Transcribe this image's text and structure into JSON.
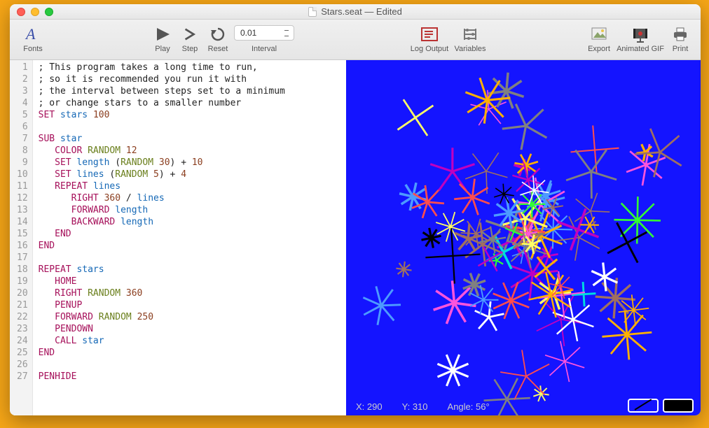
{
  "window": {
    "title": "Stars.seat — Edited"
  },
  "toolbar": {
    "fonts": "Fonts",
    "play": "Play",
    "step": "Step",
    "reset": "Reset",
    "interval_label": "Interval",
    "interval_value": "0.01",
    "log_output": "Log Output",
    "variables": "Variables",
    "export": "Export",
    "animated_gif": "Animated GIF",
    "print": "Print"
  },
  "status": {
    "x_label": "X:",
    "x_value": "290",
    "y_label": "Y:",
    "y_value": "310",
    "angle_label": "Angle:",
    "angle_value": "56°"
  },
  "code_lines": [
    [
      [
        "comment",
        "; This program takes a long time to run,"
      ]
    ],
    [
      [
        "comment",
        "; so it is recommended you run it with"
      ]
    ],
    [
      [
        "comment",
        "; the interval between steps set to a minimum"
      ]
    ],
    [
      [
        "comment",
        "; or change stars to a smaller number"
      ]
    ],
    [
      [
        "keyword",
        "SET"
      ],
      [
        "sp",
        " "
      ],
      [
        "ident",
        "stars"
      ],
      [
        "sp",
        " "
      ],
      [
        "number",
        "100"
      ]
    ],
    [],
    [
      [
        "keyword",
        "SUB"
      ],
      [
        "sp",
        " "
      ],
      [
        "ident",
        "star"
      ]
    ],
    [
      [
        "indent",
        "   "
      ],
      [
        "keyword",
        "COLOR"
      ],
      [
        "sp",
        " "
      ],
      [
        "func",
        "RANDOM"
      ],
      [
        "sp",
        " "
      ],
      [
        "number",
        "12"
      ]
    ],
    [
      [
        "indent",
        "   "
      ],
      [
        "keyword",
        "SET"
      ],
      [
        "sp",
        " "
      ],
      [
        "ident",
        "length"
      ],
      [
        "sp",
        " "
      ],
      [
        "op",
        "("
      ],
      [
        "func",
        "RANDOM"
      ],
      [
        "sp",
        " "
      ],
      [
        "number",
        "30"
      ],
      [
        "op",
        ")"
      ],
      [
        "sp",
        " "
      ],
      [
        "op",
        "+"
      ],
      [
        "sp",
        " "
      ],
      [
        "number",
        "10"
      ]
    ],
    [
      [
        "indent",
        "   "
      ],
      [
        "keyword",
        "SET"
      ],
      [
        "sp",
        " "
      ],
      [
        "ident",
        "lines"
      ],
      [
        "sp",
        " "
      ],
      [
        "op",
        "("
      ],
      [
        "func",
        "RANDOM"
      ],
      [
        "sp",
        " "
      ],
      [
        "number",
        "5"
      ],
      [
        "op",
        ")"
      ],
      [
        "sp",
        " "
      ],
      [
        "op",
        "+"
      ],
      [
        "sp",
        " "
      ],
      [
        "number",
        "4"
      ]
    ],
    [
      [
        "indent",
        "   "
      ],
      [
        "keyword",
        "REPEAT"
      ],
      [
        "sp",
        " "
      ],
      [
        "ident",
        "lines"
      ]
    ],
    [
      [
        "indent",
        "      "
      ],
      [
        "keyword",
        "RIGHT"
      ],
      [
        "sp",
        " "
      ],
      [
        "number",
        "360"
      ],
      [
        "sp",
        " "
      ],
      [
        "op",
        "/"
      ],
      [
        "sp",
        " "
      ],
      [
        "ident",
        "lines"
      ]
    ],
    [
      [
        "indent",
        "      "
      ],
      [
        "keyword",
        "FORWARD"
      ],
      [
        "sp",
        " "
      ],
      [
        "ident",
        "length"
      ]
    ],
    [
      [
        "indent",
        "      "
      ],
      [
        "keyword",
        "BACKWARD"
      ],
      [
        "sp",
        " "
      ],
      [
        "ident",
        "length"
      ]
    ],
    [
      [
        "indent",
        "   "
      ],
      [
        "keyword",
        "END"
      ]
    ],
    [
      [
        "keyword",
        "END"
      ]
    ],
    [],
    [
      [
        "keyword",
        "REPEAT"
      ],
      [
        "sp",
        " "
      ],
      [
        "ident",
        "stars"
      ]
    ],
    [
      [
        "indent",
        "   "
      ],
      [
        "keyword",
        "HOME"
      ]
    ],
    [
      [
        "indent",
        "   "
      ],
      [
        "keyword",
        "RIGHT"
      ],
      [
        "sp",
        " "
      ],
      [
        "func",
        "RANDOM"
      ],
      [
        "sp",
        " "
      ],
      [
        "number",
        "360"
      ]
    ],
    [
      [
        "indent",
        "   "
      ],
      [
        "keyword",
        "PENUP"
      ]
    ],
    [
      [
        "indent",
        "   "
      ],
      [
        "keyword",
        "FORWARD"
      ],
      [
        "sp",
        " "
      ],
      [
        "func",
        "RANDOM"
      ],
      [
        "sp",
        " "
      ],
      [
        "number",
        "250"
      ]
    ],
    [
      [
        "indent",
        "   "
      ],
      [
        "keyword",
        "PENDOWN"
      ]
    ],
    [
      [
        "indent",
        "   "
      ],
      [
        "keyword",
        "CALL"
      ],
      [
        "sp",
        " "
      ],
      [
        "ident",
        "star"
      ]
    ],
    [
      [
        "keyword",
        "END"
      ]
    ],
    [],
    [
      [
        "keyword",
        "PENHIDE"
      ]
    ]
  ],
  "canvas": {
    "background": "#1414ff",
    "star_count": 80,
    "palette": [
      "#ffffff",
      "#000000",
      "#ff4d4d",
      "#33ff33",
      "#4d9bff",
      "#ffb000",
      "#a07060",
      "#00dddd",
      "#ff55dd",
      "#c000c0",
      "#ffff66",
      "#808080"
    ]
  }
}
